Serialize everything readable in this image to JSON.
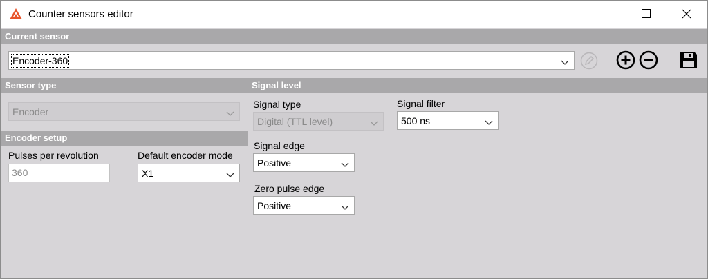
{
  "window": {
    "title": "Counter sensors editor",
    "icons": {
      "app": "app-logo-icon",
      "minimize": "minimize-icon",
      "maximize": "maximize-icon",
      "close": "close-icon"
    }
  },
  "current_sensor": {
    "header": "Current sensor",
    "selected": "Encoder-360",
    "buttons": {
      "edit": "pencil-icon",
      "add": "plus-circle-icon",
      "remove": "minus-circle-icon",
      "save": "floppy-disk-icon"
    }
  },
  "sensor_type": {
    "header": "Sensor type",
    "selected": "Encoder"
  },
  "encoder_setup": {
    "header": "Encoder setup",
    "pulses_label": "Pulses per revolution",
    "pulses_value": "360",
    "mode_label": "Default encoder mode",
    "mode_value": "X1"
  },
  "signal_level": {
    "header": "Signal level",
    "signal_type_label": "Signal type",
    "signal_type_value": "Digital (TTL level)",
    "signal_filter_label": "Signal filter",
    "signal_filter_value": "500 ns",
    "signal_edge_label": "Signal edge",
    "signal_edge_value": "Positive",
    "zero_pulse_label": "Zero pulse edge",
    "zero_pulse_value": "Positive"
  },
  "colors": {
    "panel_bg": "#d7d5d8",
    "section_header": "#a9a8aa",
    "brand_accent": "#e8542b"
  }
}
